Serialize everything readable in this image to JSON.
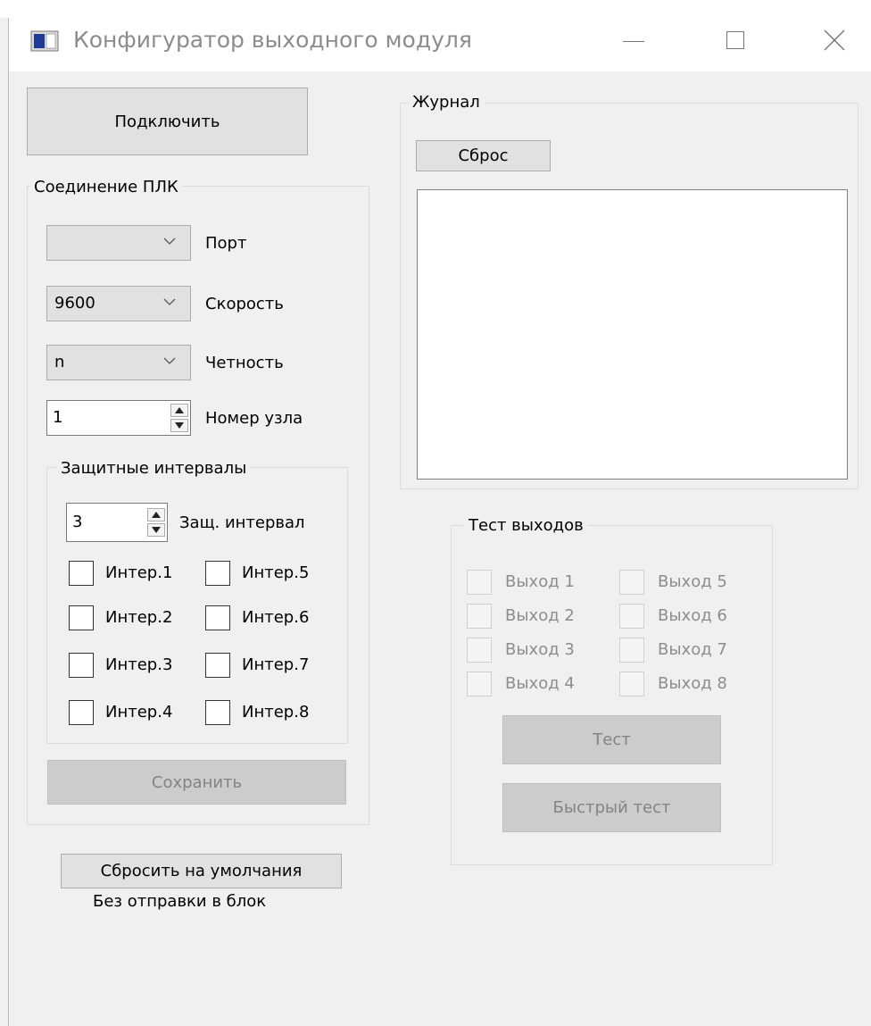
{
  "window": {
    "title": "Конфигуратор выходного модуля",
    "icon": "app-window-icon"
  },
  "connect_button": "Подключить",
  "plc": {
    "title": "Соединение ПЛК",
    "port": {
      "value": "",
      "label": "Порт"
    },
    "speed": {
      "value": "9600",
      "label": "Скорость"
    },
    "parity": {
      "value": "n",
      "label": "Четность"
    },
    "node": {
      "value": "1",
      "label": "Номер узла"
    },
    "protective": {
      "title": "Защитные интервалы",
      "interval": {
        "value": "3",
        "label": "Защ. интервал"
      },
      "checkboxes": [
        {
          "label": "Интер.1",
          "checked": false
        },
        {
          "label": "Интер.2",
          "checked": false
        },
        {
          "label": "Интер.3",
          "checked": false
        },
        {
          "label": "Интер.4",
          "checked": false
        },
        {
          "label": "Интер.5",
          "checked": false
        },
        {
          "label": "Интер.6",
          "checked": false
        },
        {
          "label": "Интер.7",
          "checked": false
        },
        {
          "label": "Интер.8",
          "checked": false
        }
      ]
    },
    "save_button": "Сохранить"
  },
  "reset_defaults_button": "Сбросить на умолчания",
  "reset_note": "Без отправки в блок",
  "journal": {
    "title": "Журнал",
    "reset_button": "Сброс",
    "content": ""
  },
  "test_outputs": {
    "title": "Тест выходов",
    "outputs": [
      {
        "label": "Выход 1",
        "checked": false
      },
      {
        "label": "Выход 2",
        "checked": false
      },
      {
        "label": "Выход 3",
        "checked": false
      },
      {
        "label": "Выход 4",
        "checked": false
      },
      {
        "label": "Выход 5",
        "checked": false
      },
      {
        "label": "Выход 6",
        "checked": false
      },
      {
        "label": "Выход 7",
        "checked": false
      },
      {
        "label": "Выход 8",
        "checked": false
      }
    ],
    "test_button": "Тест",
    "quick_test_button": "Быстрый тест"
  }
}
